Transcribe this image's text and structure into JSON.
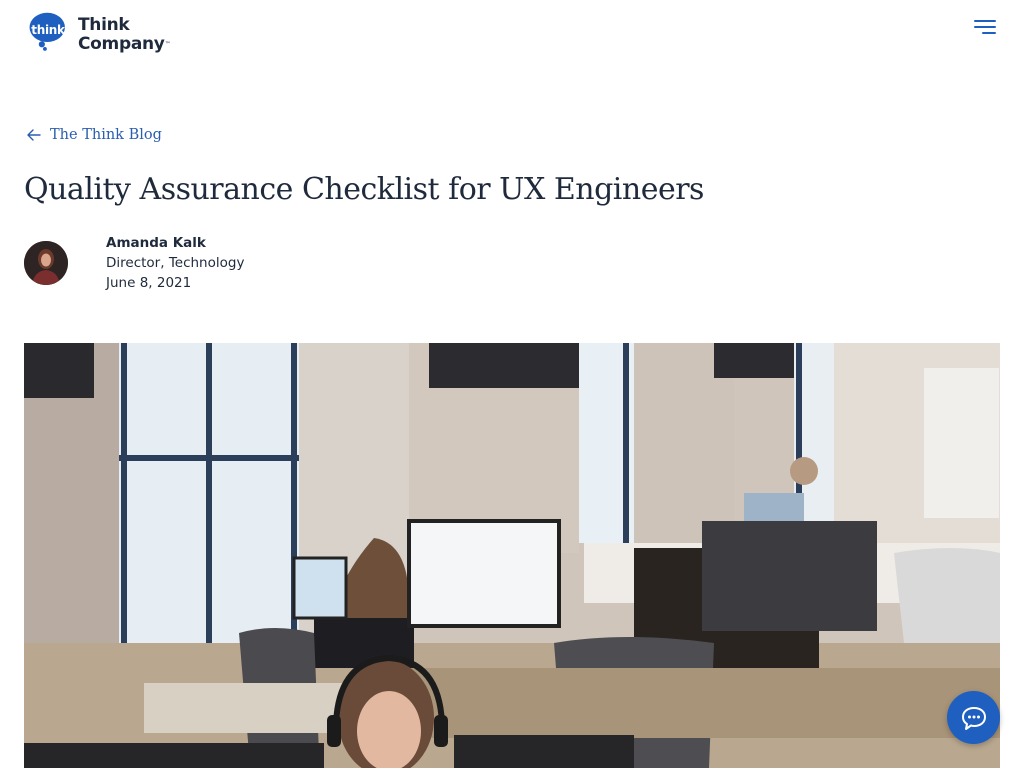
{
  "header": {
    "logo": {
      "bubble_text": "think",
      "name_line1": "Think",
      "name_line2": "Company",
      "trademark": "™"
    },
    "menu_icon": "hamburger-menu-icon"
  },
  "breadcrumb": {
    "back_icon": "arrow-left-icon",
    "label": "The Think Blog"
  },
  "article": {
    "title": "Quality Assurance Checklist for UX Engineers",
    "author": {
      "name": "Amanda Kalk",
      "role": "Director, Technology",
      "avatar_icon": "author-photo"
    },
    "date": "June 8, 2021",
    "hero_image": "office-workspace-photo"
  },
  "chat": {
    "icon": "chat-bubble-icon"
  },
  "colors": {
    "brand_blue": "#1f5fbf",
    "link_blue": "#2a5db0",
    "text_dark": "#1f2a3c"
  }
}
